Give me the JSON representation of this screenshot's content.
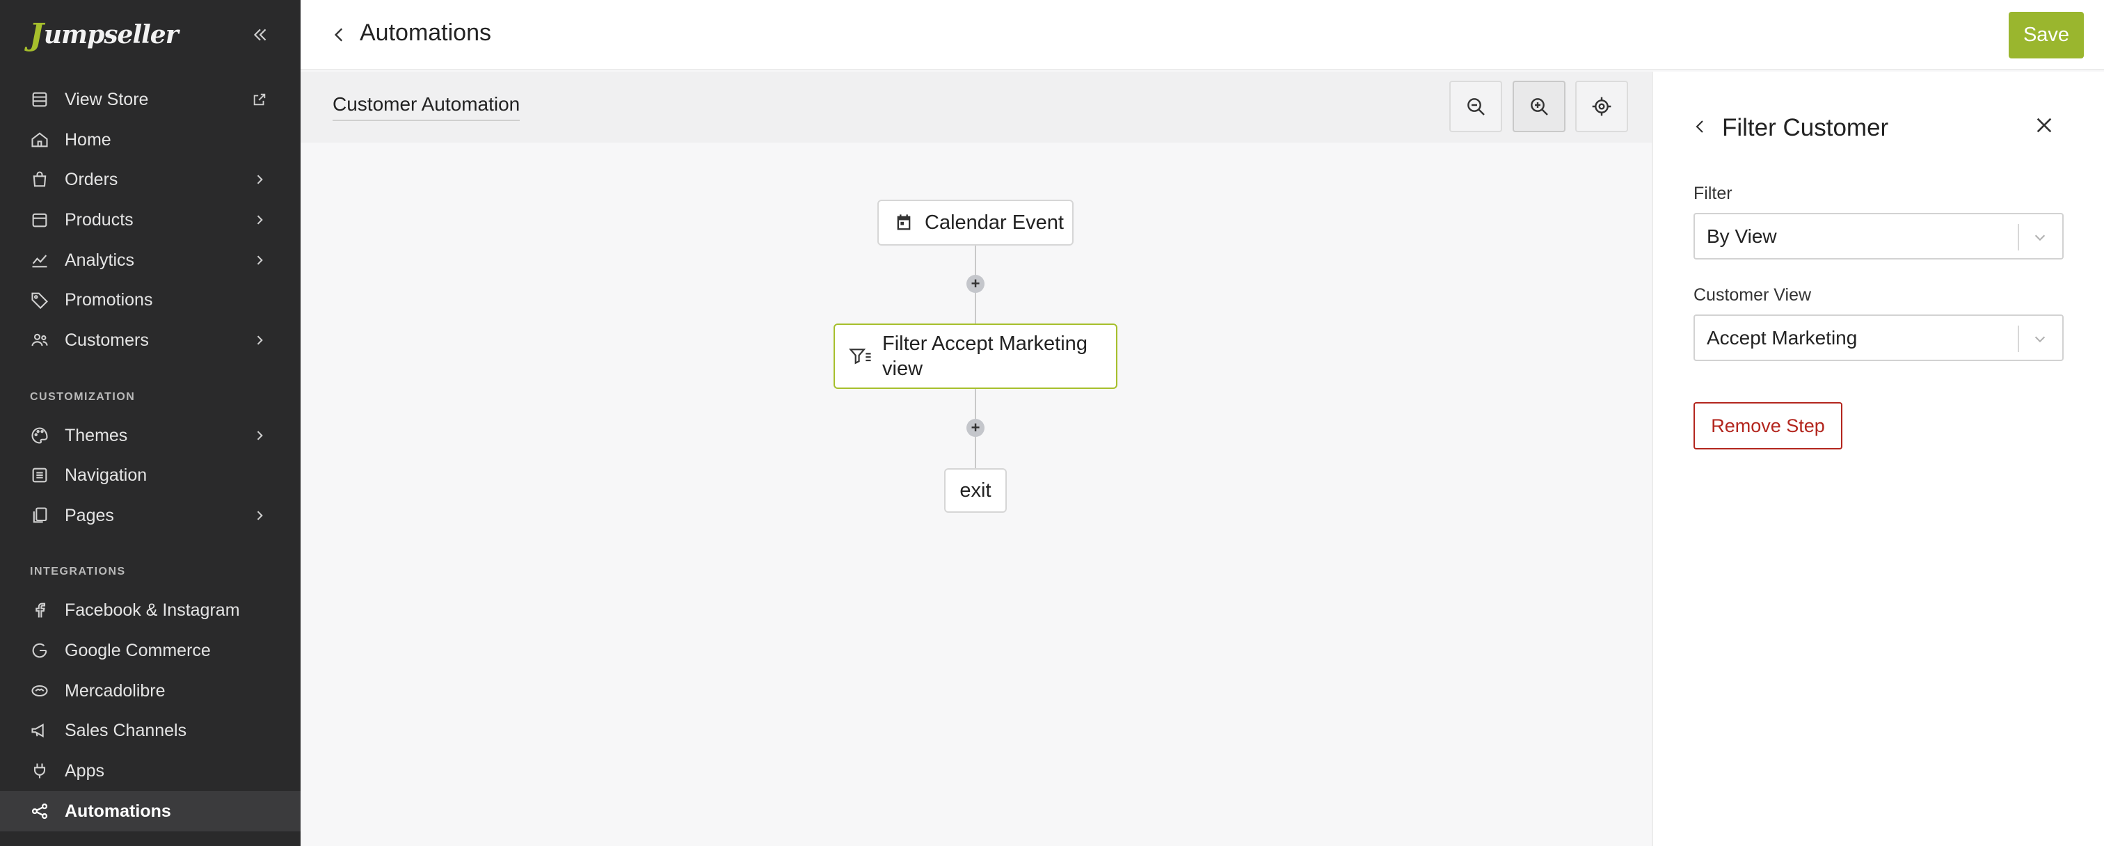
{
  "brand": {
    "logo_text": "umpseller",
    "logo_initial": "J",
    "accent": "#9ab62e"
  },
  "sidebar": {
    "items": [
      {
        "label": "View Store",
        "icon": "store-icon",
        "has_chevron": false,
        "external": true
      },
      {
        "label": "Home",
        "icon": "home-icon",
        "has_chevron": false
      },
      {
        "label": "Orders",
        "icon": "bag-icon",
        "has_chevron": true
      },
      {
        "label": "Products",
        "icon": "box-icon",
        "has_chevron": true
      },
      {
        "label": "Analytics",
        "icon": "chart-icon",
        "has_chevron": true
      },
      {
        "label": "Promotions",
        "icon": "tag-icon",
        "has_chevron": false
      },
      {
        "label": "Customers",
        "icon": "users-icon",
        "has_chevron": true
      }
    ],
    "customization_title": "CUSTOMIZATION",
    "customization_items": [
      {
        "label": "Themes",
        "icon": "palette-icon",
        "has_chevron": true
      },
      {
        "label": "Navigation",
        "icon": "list-icon",
        "has_chevron": false
      },
      {
        "label": "Pages",
        "icon": "pages-icon",
        "has_chevron": true
      }
    ],
    "integrations_title": "INTEGRATIONS",
    "integration_items": [
      {
        "label": "Facebook & Instagram",
        "icon": "facebook-icon"
      },
      {
        "label": "Google Commerce",
        "icon": "google-icon"
      },
      {
        "label": "Mercadolibre",
        "icon": "handshake-icon"
      },
      {
        "label": "Sales Channels",
        "icon": "megaphone-icon"
      },
      {
        "label": "Apps",
        "icon": "plug-icon"
      },
      {
        "label": "Automations",
        "icon": "share-icon",
        "active": true
      }
    ]
  },
  "header": {
    "title": "Automations",
    "save_label": "Save"
  },
  "canvas": {
    "automation_name": "Customer Automation",
    "nodes": {
      "trigger": "Calendar Event",
      "filter_line1": "Filter Accept Marketing",
      "filter_line2": "view",
      "exit": "exit"
    }
  },
  "panel": {
    "title": "Filter Customer",
    "filter_label": "Filter",
    "filter_value": "By View",
    "view_label": "Customer View",
    "view_value": "Accept Marketing",
    "remove_label": "Remove Step"
  }
}
